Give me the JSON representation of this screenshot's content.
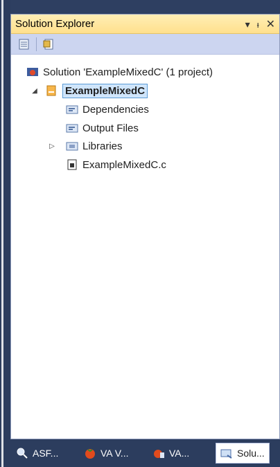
{
  "panel": {
    "title": "Solution Explorer",
    "title_controls": {
      "dropdown": "▾",
      "pin": "ᵼ",
      "close": "✕"
    }
  },
  "tree": {
    "solution_label": "Solution 'ExampleMixedC' (1 project)",
    "project_label": "ExampleMixedC",
    "items": [
      {
        "label": "Dependencies",
        "icon": "folder-filter-icon"
      },
      {
        "label": "Output Files",
        "icon": "folder-filter-icon"
      },
      {
        "label": "Libraries",
        "icon": "library-folder-icon"
      },
      {
        "label": "ExampleMixedC.c",
        "icon": "c-file-icon"
      }
    ]
  },
  "bottom_tabs": [
    {
      "label": "ASF...",
      "icon": "magnifier-icon",
      "active": false
    },
    {
      "label": "VA V...",
      "icon": "tomato-icon",
      "active": false
    },
    {
      "label": "VA...",
      "icon": "tomato-outline-icon",
      "active": false
    },
    {
      "label": "Solu...",
      "icon": "solution-explorer-icon",
      "active": true
    }
  ],
  "colors": {
    "title_bar": "#ffe08d",
    "toolbar": "#ccd5f0",
    "ide_background": "#2c3d5e",
    "selection": "#cfe5fb"
  }
}
